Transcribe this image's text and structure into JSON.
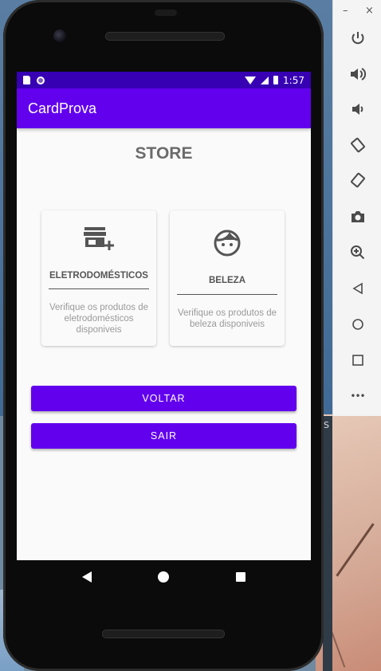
{
  "app": {
    "title": "CardProva",
    "status_time": "1:57"
  },
  "screen": {
    "heading": "STORE",
    "cards": [
      {
        "icon": "store-add-icon",
        "title": "ELETRODOMÉSTICOS",
        "description": "Verifique os produtos de eletrodomésticos disponiveis"
      },
      {
        "icon": "face-icon",
        "title": "BELEZA",
        "description": "Verifique os produtos de beleza disponiveis"
      }
    ],
    "buttons": {
      "back": "VOLTAR",
      "exit": "SAIR"
    }
  },
  "emulator_panel": {
    "minimize": "–",
    "close": "×",
    "more": "•••",
    "items": [
      "power-icon",
      "volume-up-icon",
      "volume-down-icon",
      "rotate-left-icon",
      "rotate-right-icon",
      "camera-icon",
      "zoom-icon",
      "back-icon",
      "home-icon",
      "overview-icon",
      "more-icon"
    ]
  },
  "colors": {
    "primary": "#6200ee",
    "primary_dark": "#3700b3"
  }
}
